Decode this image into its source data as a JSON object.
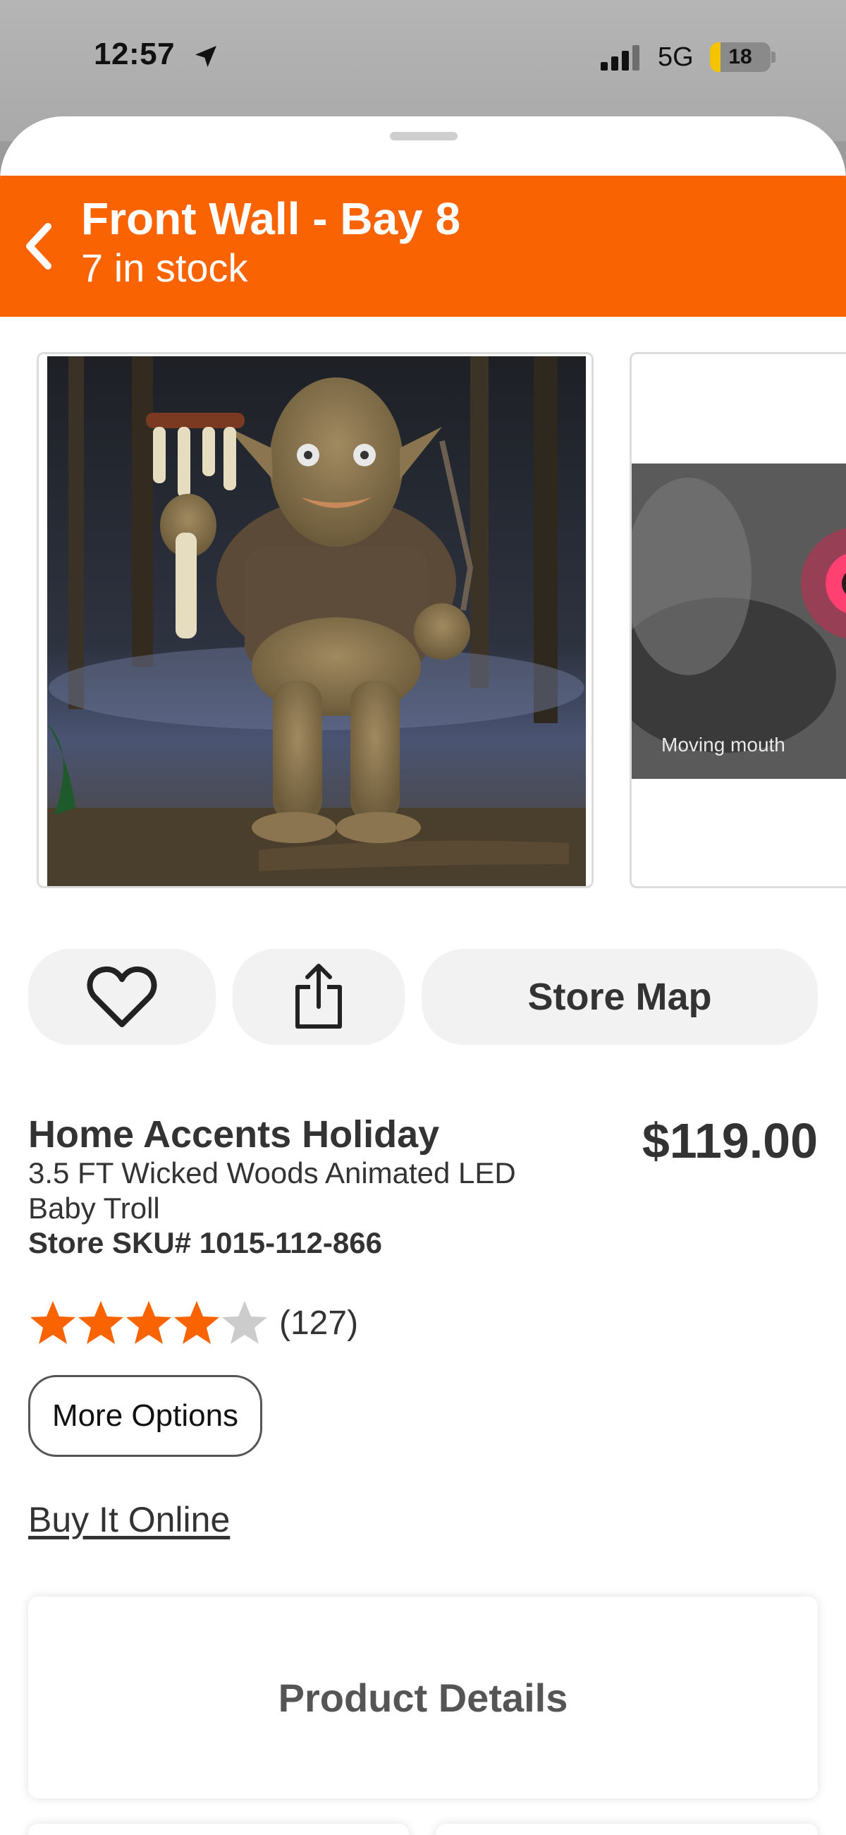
{
  "status_bar": {
    "time": "12:57",
    "network": "5G",
    "battery_level": "18",
    "battery_fraction": 0.18
  },
  "location": {
    "title": "Front Wall - Bay 8",
    "stock": "7 in stock"
  },
  "gallery": {
    "second_image_caption": "Moving mouth"
  },
  "actions": {
    "store_map_label": "Store Map"
  },
  "product": {
    "brand": "Home Accents Holiday",
    "name": "3.5 FT Wicked Woods Animated LED Baby Troll",
    "sku": "Store SKU# 1015-112-866",
    "price": "$119.00",
    "rating": 4,
    "rating_max": 5,
    "review_count": "(127)"
  },
  "buttons": {
    "more_options": "More Options",
    "buy_online": "Buy It Online"
  },
  "sections": {
    "product_details": "Product Details"
  },
  "colors": {
    "brand_orange": "#f96302",
    "star_filled": "#f96302",
    "star_empty": "#cccccc"
  },
  "icons": [
    "location-arrow-icon",
    "signal-icon",
    "battery-icon",
    "back-chevron-icon",
    "heart-icon",
    "share-icon",
    "star-icon"
  ]
}
